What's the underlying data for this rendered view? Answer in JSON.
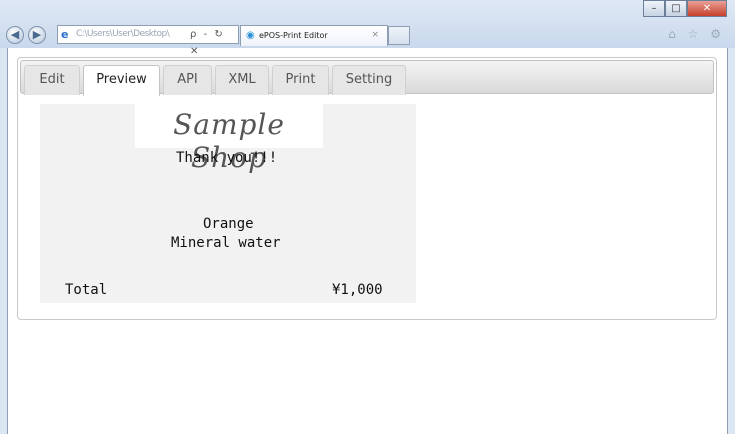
{
  "browser": {
    "address_url": "C:\\Users\\User\\Desktop\\",
    "address_controls": "ρ - ↻ ✕",
    "tab_title": "ePOS-Print Editor",
    "tab_close": "×",
    "tools": "⌂ ☆ ⚙"
  },
  "window_controls": {
    "minimize": "–",
    "maximize": "□",
    "close": "✕"
  },
  "app": {
    "tabs": [
      {
        "label": "Edit",
        "active": false
      },
      {
        "label": "Preview",
        "active": true
      },
      {
        "label": "API",
        "active": false
      },
      {
        "label": "XML",
        "active": false
      },
      {
        "label": "Print",
        "active": false
      },
      {
        "label": "Setting",
        "active": false
      }
    ]
  },
  "receipt": {
    "logo_text": "Sample Shop",
    "thanks": "Thank you!!!",
    "items": [
      "Orange",
      "Mineral water"
    ],
    "total_label": "Total",
    "total_value": "¥1,000"
  }
}
